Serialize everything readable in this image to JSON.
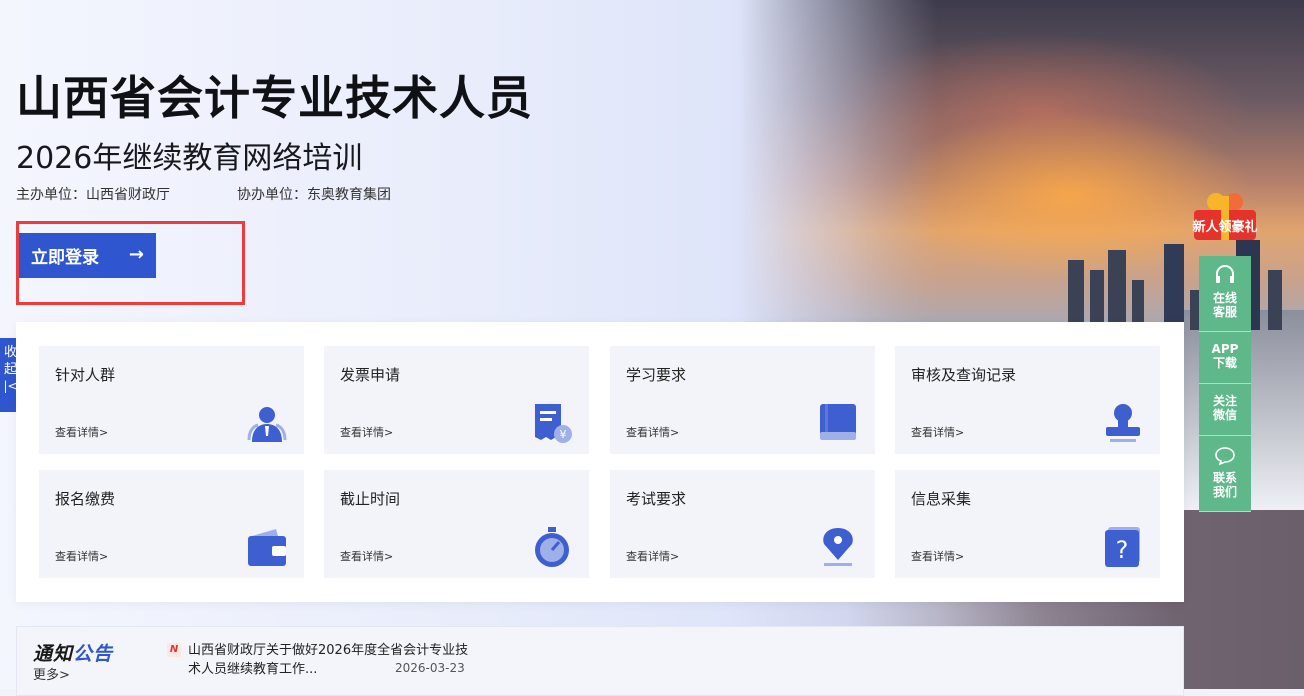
{
  "hero": {
    "title": "山西省会计专业技术人员",
    "subtitle": "2026年继续教育网络培训",
    "host": "主办单位：山西省财政厅",
    "co_host": "协办单位：东奥教育集团",
    "login_label": "立即登录",
    "login_arrow": "→"
  },
  "collapse": {
    "label": "收起"
  },
  "cards": [
    {
      "title": "针对人群",
      "more": "查看详情>",
      "icon": "user-group-icon"
    },
    {
      "title": "发票申请",
      "more": "查看详情>",
      "icon": "invoice-icon"
    },
    {
      "title": "学习要求",
      "more": "查看详情>",
      "icon": "book-icon"
    },
    {
      "title": "审核及查询记录",
      "more": "查看详情>",
      "icon": "stamp-icon"
    },
    {
      "title": "报名缴费",
      "more": "查看详情>",
      "icon": "wallet-icon"
    },
    {
      "title": "截止时间",
      "more": "查看详情>",
      "icon": "stopwatch-icon"
    },
    {
      "title": "考试要求",
      "more": "查看详情>",
      "icon": "pen-nib-icon"
    },
    {
      "title": "信息采集",
      "more": "查看详情>",
      "icon": "question-card-icon"
    }
  ],
  "notice": {
    "title_a": "通知",
    "title_b": "公告",
    "more": "更多>",
    "badge": "N",
    "item_text": "山西省财政厅关于做好2026年度全省会计专业技术人员继续教育工作...",
    "item_date": "2026-03-23"
  },
  "sidebar": {
    "gift": "新人领豪礼",
    "items": [
      {
        "label": "在线客服",
        "icon": "headset-icon"
      },
      {
        "label": "APP下载",
        "icon": ""
      },
      {
        "label": "关注微信",
        "icon": ""
      },
      {
        "label": "联系我们",
        "icon": "chat-bubble-icon"
      }
    ]
  },
  "colors": {
    "accent": "#2f56cf",
    "side_green": "#5fb889",
    "highlight_red": "#ee3b3b"
  }
}
